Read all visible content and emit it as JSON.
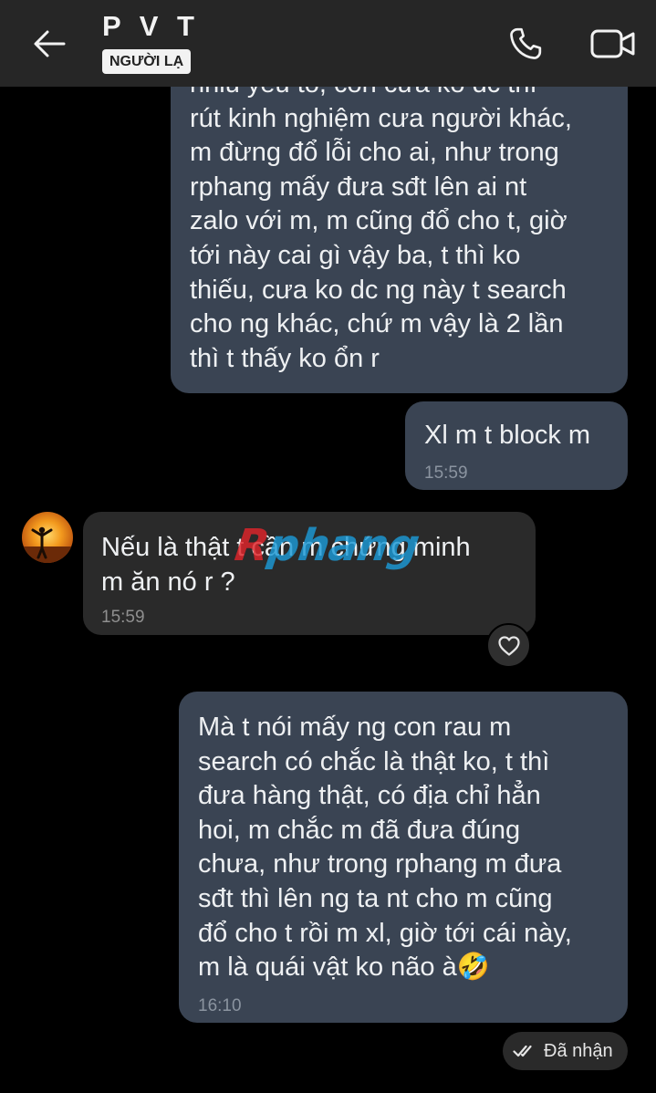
{
  "header": {
    "title": "P V T",
    "badge": "NGƯỜI LẠ",
    "back_icon": "arrow-left-icon",
    "call_icon": "phone-icon",
    "video_icon": "video-camera-icon"
  },
  "messages": [
    {
      "direction": "out",
      "text": "nhiu yếu tố, còn cưa ko dc thì\nrút kinh nghiệm cưa người khác,\nm đừng đổ lỗi cho ai, như trong\nrphang mấy đưa sđt lên ai nt\nzalo với m, m cũng đổ cho t, giờ\ntới này cai gì vậy ba, t thì ko\nthiếu, cưa ko dc ng này t search\ncho ng khác, chứ m vậy là 2 lần\nthì t thấy ko ổn r"
    },
    {
      "direction": "out",
      "text": "Xl m t block m",
      "time": "15:59"
    },
    {
      "direction": "in",
      "text": "Nếu là thật t cần m chứng minh\nm ăn nó r ?",
      "time": "15:59"
    },
    {
      "direction": "out",
      "text": "Mà t nói mấy ng con rau m\nsearch có chắc là thật ko, t thì\nđưa hàng thật, có địa chỉ hẳn\nhoi, m chắc m đã đưa đúng\nchưa, như trong rphang m đưa\nsđt thì lên ng ta nt cho m cũng\nđổ cho t rồi m xl, giờ tới cái này,\nm là quái vật ko não à🤣",
      "time": "16:10"
    }
  ],
  "reaction": {
    "icon": "heart-outline-icon"
  },
  "status": {
    "label": "Đã nhận",
    "icon": "double-check-icon"
  },
  "watermark": {
    "part1": "R",
    "part2": "phang",
    "colors": {
      "part1": "#e0242a",
      "part2": "#1c9ad6"
    }
  },
  "colors": {
    "header_bg": "#262626",
    "background": "#000000",
    "outgoing_bubble": "#3a4453",
    "incoming_bubble": "#2a2a2a"
  }
}
